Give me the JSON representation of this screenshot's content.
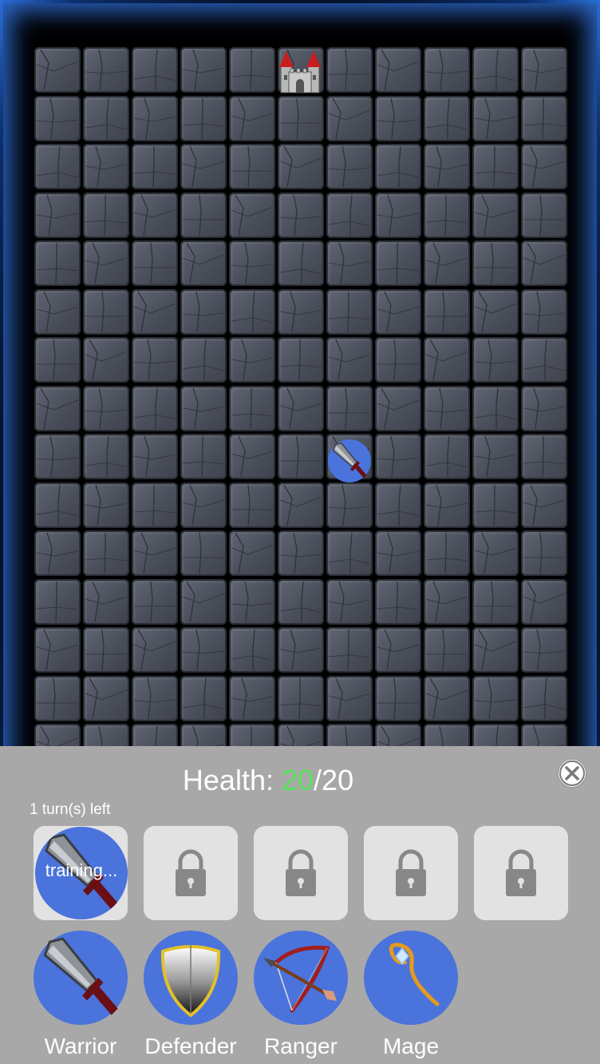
{
  "board": {
    "columns": 11,
    "rows": 15,
    "castle_icon": "castle-icon",
    "unit_on_board": "warrior-sword-icon"
  },
  "panel": {
    "health_label": "Health: ",
    "health_current": "20",
    "health_separator": "/",
    "health_max": "20",
    "turns_left": "1 turn(s) left",
    "training_text": "training...",
    "close_icon": "close-icon",
    "slots": [
      {
        "state": "training",
        "icon": "warrior-sword-icon"
      },
      {
        "state": "locked",
        "icon": "lock-icon"
      },
      {
        "state": "locked",
        "icon": "lock-icon"
      },
      {
        "state": "locked",
        "icon": "lock-icon"
      },
      {
        "state": "locked",
        "icon": "lock-icon"
      }
    ],
    "units": [
      {
        "label": "Warrior",
        "icon": "sword-icon"
      },
      {
        "label": "Defender",
        "icon": "shield-icon"
      },
      {
        "label": "Ranger",
        "icon": "bow-icon"
      },
      {
        "label": "Mage",
        "icon": "staff-icon"
      }
    ]
  },
  "colors": {
    "token_blue": "#4a73dc",
    "health_green": "#59e35a",
    "panel_gray": "#a8a8a8",
    "slot_gray": "#e2e2e2"
  }
}
